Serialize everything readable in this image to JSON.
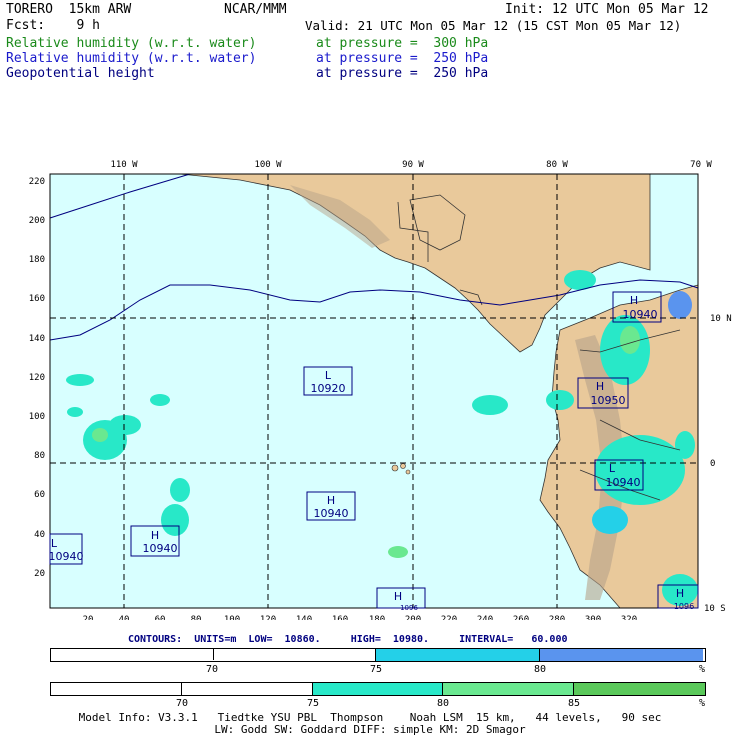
{
  "header": {
    "model": "TORERO  15km ARW",
    "org": "NCAR/MMM",
    "init": "Init: 12 UTC Mon 05 Mar 12",
    "fcst": "Fcst:    9 h",
    "valid": "Valid: 21 UTC Mon 05 Mar 12 (15 CST Mon 05 Mar 12)",
    "fields": [
      {
        "name": "Relative humidity (w.r.t. water)",
        "level": "at pressure =  300 hPa",
        "color": "#1a8a1a"
      },
      {
        "name": "Relative humidity (w.r.t. water)",
        "level": "at pressure =  250 hPa",
        "color": "#1a1acc"
      },
      {
        "name": "Geopotential height",
        "level": "at pressure =  250 hPa",
        "color": "#000080"
      }
    ]
  },
  "map": {
    "lon_labels": [
      "110 W",
      "100 W",
      "90 W",
      "80 W",
      "70 W"
    ],
    "lat_labels": [
      "10 N",
      "0",
      "10 S"
    ],
    "x_ticks": [
      "20",
      "40",
      "60",
      "80",
      "100",
      "120",
      "140",
      "160",
      "180",
      "200",
      "220",
      "240",
      "260",
      "280",
      "300",
      "320"
    ],
    "y_ticks": [
      "220",
      "200",
      "180",
      "160",
      "140",
      "120",
      "100",
      "80",
      "60",
      "40",
      "20"
    ],
    "ocean_color": "#d8ffff",
    "land_color": "#e9c99b",
    "centers": [
      {
        "type": "L",
        "value": "10920"
      },
      {
        "type": "H",
        "value": "10940"
      },
      {
        "type": "H",
        "value": "10940"
      },
      {
        "type": "L",
        "value": "10940"
      },
      {
        "type": "H",
        "value": "10940"
      },
      {
        "type": "H",
        "value": "10950"
      },
      {
        "type": "L",
        "value": "10940"
      },
      {
        "type": "H",
        "value": "1096"
      },
      {
        "type": "H",
        "value": "1096"
      }
    ]
  },
  "contour_info": "CONTOURS:  UNITS=m  LOW=  10860.     HIGH=  10980.     INTERVAL=   60.000",
  "colorbar_250": {
    "labels": [
      "70",
      "75",
      "80",
      "%"
    ],
    "colors": [
      "#ffffff",
      "#24d0e8",
      "#5a94ee"
    ]
  },
  "colorbar_300": {
    "labels": [
      "70",
      "75",
      "80",
      "85",
      "%"
    ],
    "colors": [
      "#ffffff",
      "#28e8c8",
      "#6ae890",
      "#5ac85a"
    ]
  },
  "footer": {
    "line1": "Model Info: V3.3.1   Tiedtke YSU PBL  Thompson    Noah LSM  15 km,   44 levels,   90 sec",
    "line2": "LW: Godd SW: Goddard DIFF: simple KM: 2D Smagor"
  }
}
